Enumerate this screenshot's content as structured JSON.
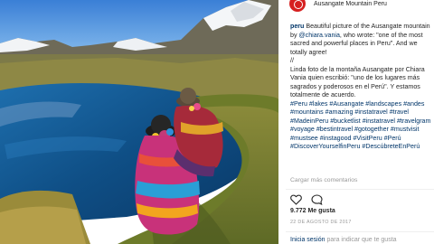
{
  "post": {
    "account_location": "Ausangate Mountain Peru",
    "caption": {
      "username": "peru",
      "text_before_mention": " Beautiful picture of the Ausangate mountain by ",
      "mention": "@chiara.vania",
      "text_after_mention": ", who wrote: \"one of the most sacred and powerful places in Peru\". And we totally agree!",
      "separator": "//",
      "spanish_before_mention": "Linda foto de la montaña Ausangate por Chiara Vania quien escribió: \"uno de los lugares más sagrados y poderosos en el Perú\". Y estamos totalmente de acuerdo.",
      "hashtags": [
        "#Peru",
        "#lakes",
        "#Ausangate",
        "#landscapes",
        "#andes",
        "#mountains",
        "#amazing",
        "#instatravel",
        "#travel",
        "#MadeinPeru",
        "#bucketlist",
        "#instatravel",
        "#travelgram",
        "#voyage",
        "#bestintravel",
        "#gotogether",
        "#mustvisit",
        "#mustsee",
        "#instagood",
        "#VisitPeru",
        "#Perú",
        "#DiscoverYourselfinPeru",
        "#DescúbreteEnPerú"
      ]
    },
    "load_comments": "Cargar más comentarios",
    "likes": "9.772 Me gusta",
    "date": "22 DE AGOSTO DE 2017",
    "login_link": "Inicia sesión",
    "login_rest": " para indicar que te gusta",
    "icons": [
      "heart-icon",
      "comment-icon"
    ]
  }
}
